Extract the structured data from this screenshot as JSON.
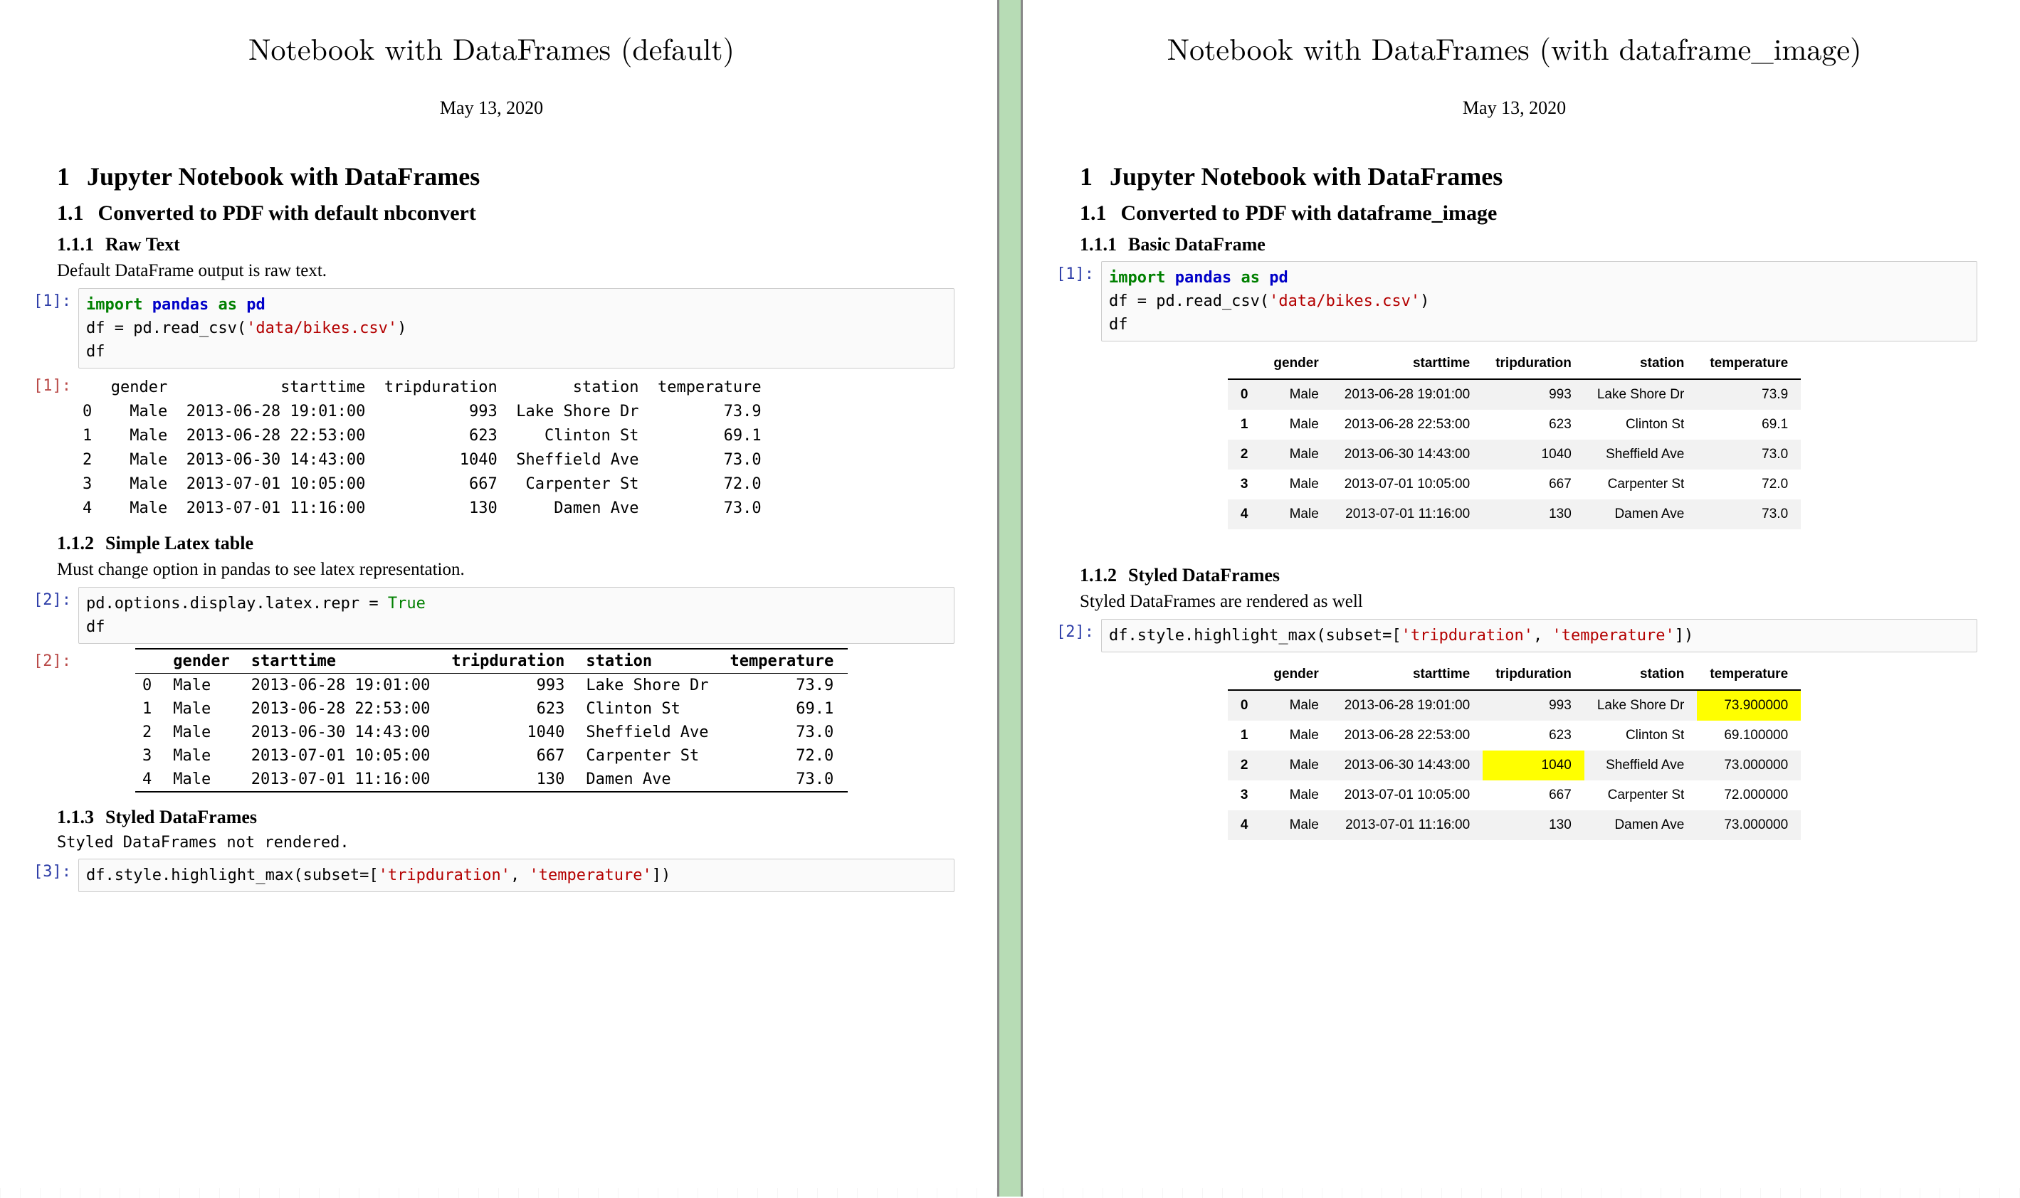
{
  "left": {
    "title": "Notebook with DataFrames (default)",
    "date": "May 13, 2020",
    "h1_num": "1",
    "h1": "Jupyter Notebook with DataFrames",
    "h2_num": "1.1",
    "h2": "Converted to PDF with default nbconvert",
    "s111_num": "1.1.1",
    "s111": "Raw Text",
    "s111_body": "Default DataFrame output is raw text.",
    "in1_prompt": "[1]:",
    "in1_code": {
      "kw_import": "import",
      "mod_pandas": "pandas",
      "kw_as": "as",
      "alias_pd": "pd",
      "line2a": "df = pd.read_csv(",
      "str": "'data/bikes.csv'",
      "line2b": ")",
      "line3": "df"
    },
    "out1_prompt": "[1]:",
    "out1_header": "   gender            starttime  tripduration        station  temperature",
    "out1_rows": [
      "0    Male  2013-06-28 19:01:00           993  Lake Shore Dr         73.9",
      "1    Male  2013-06-28 22:53:00           623     Clinton St         69.1",
      "2    Male  2013-06-30 14:43:00          1040  Sheffield Ave         73.0",
      "3    Male  2013-07-01 10:05:00           667   Carpenter St         72.0",
      "4    Male  2013-07-01 11:16:00           130      Damen Ave         73.0"
    ],
    "s112_num": "1.1.2",
    "s112": "Simple Latex table",
    "s112_body": "Must change option in pandas to see latex representation.",
    "in2_prompt": "[2]:",
    "in2_code_a": "pd.options.display.latex.repr = ",
    "in2_code_true": "True",
    "in2_code_b": "df",
    "out2_prompt": "[2]:",
    "latex_header": [
      "",
      "gender",
      "starttime",
      "tripduration",
      "station",
      "temperature"
    ],
    "latex_rows": [
      [
        "0",
        "Male",
        "2013-06-28 19:01:00",
        "993",
        "Lake Shore Dr",
        "73.9"
      ],
      [
        "1",
        "Male",
        "2013-06-28 22:53:00",
        "623",
        "Clinton St",
        "69.1"
      ],
      [
        "2",
        "Male",
        "2013-06-30 14:43:00",
        "1040",
        "Sheffield Ave",
        "73.0"
      ],
      [
        "3",
        "Male",
        "2013-07-01 10:05:00",
        "667",
        "Carpenter St",
        "72.0"
      ],
      [
        "4",
        "Male",
        "2013-07-01 11:16:00",
        "130",
        "Damen Ave",
        "73.0"
      ]
    ],
    "s113_num": "1.1.3",
    "s113": "Styled DataFrames",
    "s113_body": "Styled DataFrames not rendered.",
    "in3_prompt": "[3]:",
    "in3_code_a": "df.style.highlight_max(subset=[",
    "in3_str1": "'tripduration'",
    "in3_code_b": ", ",
    "in3_str2": "'temperature'",
    "in3_code_c": "])"
  },
  "right": {
    "title": "Notebook with DataFrames (with dataframe_image)",
    "date": "May 13, 2020",
    "h1_num": "1",
    "h1": "Jupyter Notebook with DataFrames",
    "h2_num": "1.1",
    "h2": "Converted to PDF with dataframe_image",
    "s111_num": "1.1.1",
    "s111": "Basic DataFrame",
    "in1_prompt": "[1]:",
    "in1_code": {
      "kw_import": "import",
      "mod_pandas": "pandas",
      "kw_as": "as",
      "alias_pd": "pd",
      "line2a": "df = pd.read_csv(",
      "str": "'data/bikes.csv'",
      "line2b": ")",
      "line3": "df"
    },
    "html_header": [
      "",
      "gender",
      "starttime",
      "tripduration",
      "station",
      "temperature"
    ],
    "html_rows": [
      [
        "0",
        "Male",
        "2013-06-28 19:01:00",
        "993",
        "Lake Shore Dr",
        "73.9"
      ],
      [
        "1",
        "Male",
        "2013-06-28 22:53:00",
        "623",
        "Clinton St",
        "69.1"
      ],
      [
        "2",
        "Male",
        "2013-06-30 14:43:00",
        "1040",
        "Sheffield Ave",
        "73.0"
      ],
      [
        "3",
        "Male",
        "2013-07-01 10:05:00",
        "667",
        "Carpenter St",
        "72.0"
      ],
      [
        "4",
        "Male",
        "2013-07-01 11:16:00",
        "130",
        "Damen Ave",
        "73.0"
      ]
    ],
    "s112_num": "1.1.2",
    "s112": "Styled DataFrames",
    "s112_body": "Styled DataFrames are rendered as well",
    "in2_prompt": "[2]:",
    "in2_code_a": "df.style.highlight_max(subset=[",
    "in2_str1": "'tripduration'",
    "in2_code_b": ", ",
    "in2_str2": "'temperature'",
    "in2_code_c": "])",
    "styled_header": [
      "",
      "gender",
      "starttime",
      "tripduration",
      "station",
      "temperature"
    ],
    "styled_rows": [
      {
        "cells": [
          "0",
          "Male",
          "2013-06-28 19:01:00",
          "993",
          "Lake Shore Dr",
          "73.900000"
        ],
        "hl": [
          5
        ]
      },
      {
        "cells": [
          "1",
          "Male",
          "2013-06-28 22:53:00",
          "623",
          "Clinton St",
          "69.100000"
        ],
        "hl": []
      },
      {
        "cells": [
          "2",
          "Male",
          "2013-06-30 14:43:00",
          "1040",
          "Sheffield Ave",
          "73.000000"
        ],
        "hl": [
          3
        ]
      },
      {
        "cells": [
          "3",
          "Male",
          "2013-07-01 10:05:00",
          "667",
          "Carpenter St",
          "72.000000"
        ],
        "hl": []
      },
      {
        "cells": [
          "4",
          "Male",
          "2013-07-01 11:16:00",
          "130",
          "Damen Ave",
          "73.000000"
        ],
        "hl": []
      }
    ]
  }
}
